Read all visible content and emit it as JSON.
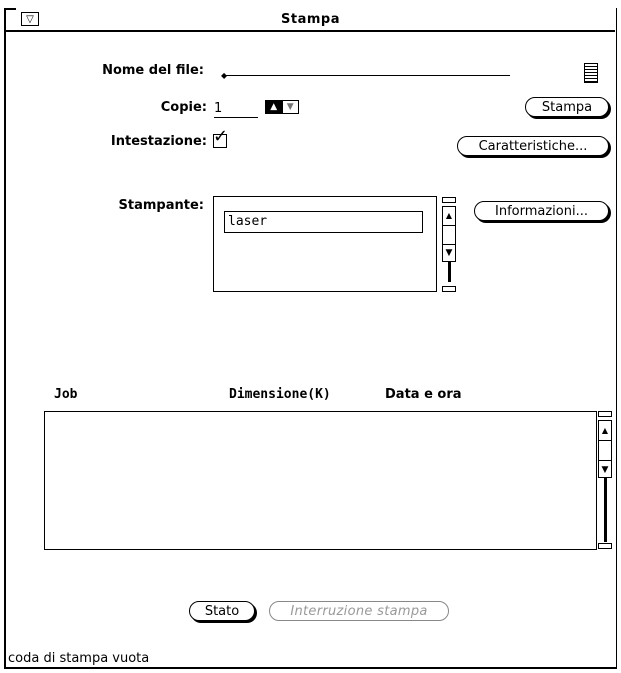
{
  "window": {
    "title": "Stampa",
    "menu_icon": "triangle-down-icon"
  },
  "filename": {
    "label": "Nome del file:",
    "value": "",
    "icon": "file-icon"
  },
  "copies": {
    "label": "Copie:",
    "value": "1"
  },
  "header": {
    "label": "Intestazione:",
    "checked": true
  },
  "buttons": {
    "print": "Stampa",
    "properties": "Caratteristiche...",
    "info": "Informazioni...",
    "status": "Stato",
    "cancel": "Interruzione stampa"
  },
  "printer": {
    "label": "Stampante:",
    "items": [
      "laser"
    ]
  },
  "jobs": {
    "columns": [
      "Job",
      "Dimensione(K)",
      "Data e ora"
    ],
    "rows": []
  },
  "footer": {
    "status_text": "coda di stampa vuota"
  }
}
